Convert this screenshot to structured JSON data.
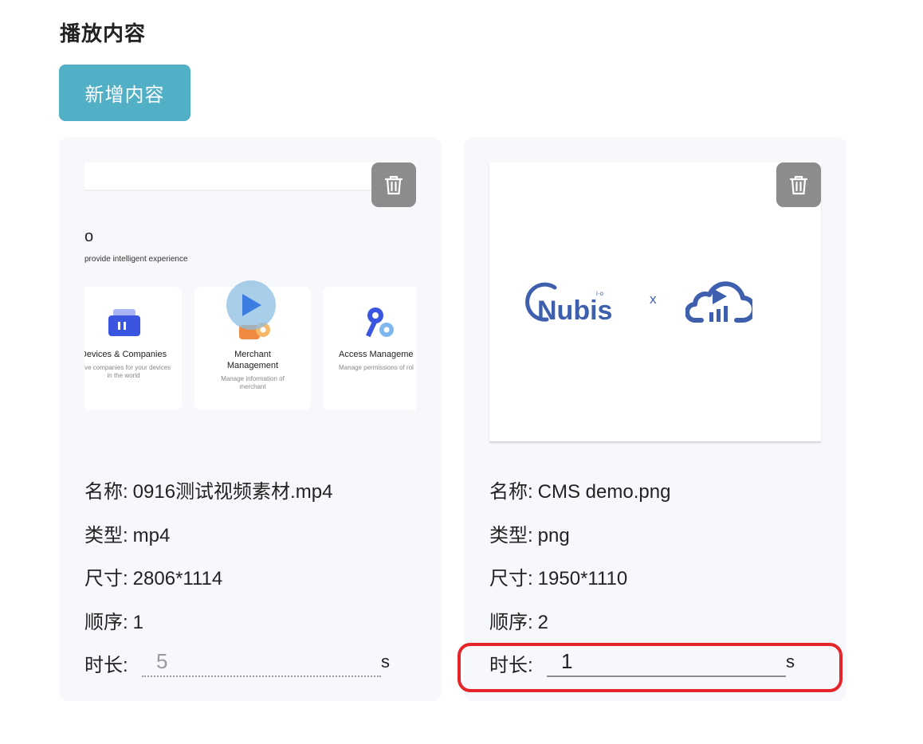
{
  "header": {
    "title": "播放内容"
  },
  "toolbar": {
    "add_label": "新增内容"
  },
  "items": [
    {
      "name_label": "名称:",
      "name_value": "0916测试视频素材.mp4",
      "type_label": "类型:",
      "type_value": "mp4",
      "size_label": "尺寸:",
      "size_value": "2806*1114",
      "order_label": "顺序:",
      "order_value": "1",
      "duration_label": "时长:",
      "duration_placeholder": "5",
      "duration_value": "",
      "duration_unit": "s",
      "preview": {
        "kind": "video",
        "partial_title": "o",
        "tagline": "provide intelligent experience",
        "tiles": [
          {
            "title": "Devices & Companies",
            "subtitle": "Have companies for your devices in the world"
          },
          {
            "title": "Merchant Management",
            "subtitle": "Manage information of merchant"
          },
          {
            "title": "Access Manageme",
            "subtitle": "Manage permissions of rol"
          }
        ]
      }
    },
    {
      "name_label": "名称:",
      "name_value": "CMS demo.png",
      "type_label": "类型:",
      "type_value": "png",
      "size_label": "尺寸:",
      "size_value": "1950*1110",
      "order_label": "顺序:",
      "order_value": "2",
      "duration_label": "时长:",
      "duration_placeholder": "",
      "duration_value": "1",
      "duration_unit": "s",
      "preview": {
        "kind": "image",
        "logo_text": "Nubis",
        "logo_superscript": "i·o",
        "separator": "x"
      }
    }
  ],
  "colors": {
    "primary": "#51afc6",
    "highlight": "#e5252a",
    "delete_bg": "#8c8c8c",
    "logo_blue": "#3d5fae"
  }
}
